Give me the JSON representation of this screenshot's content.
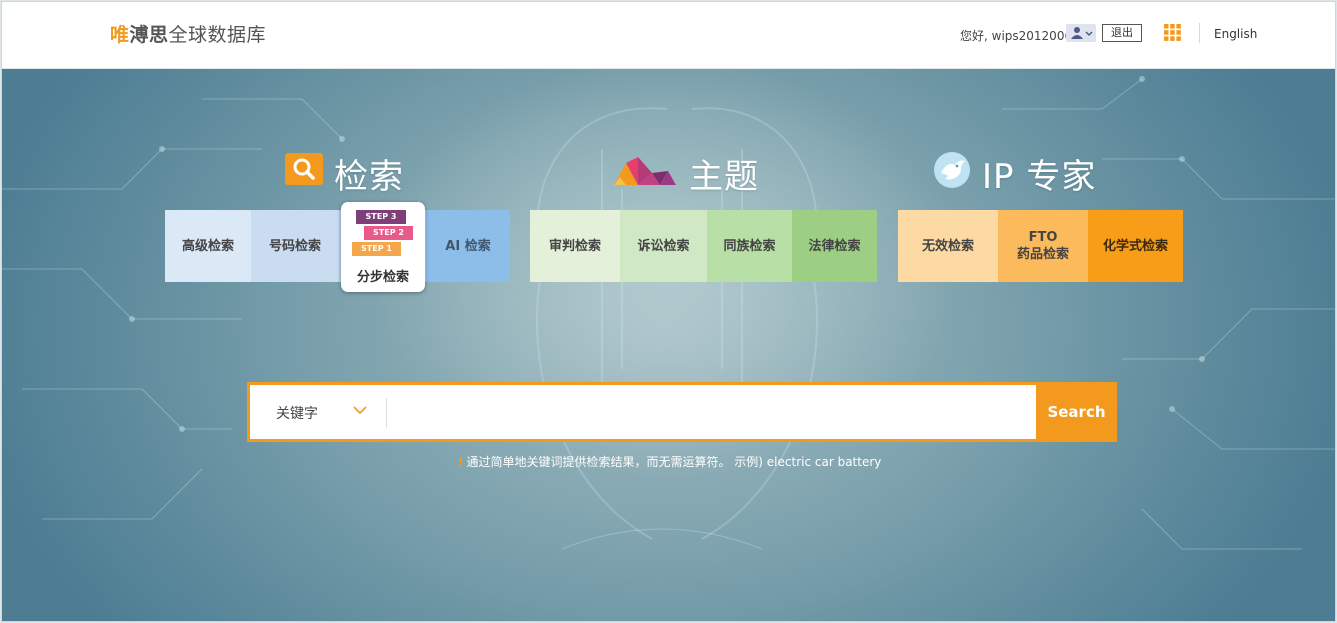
{
  "header": {
    "logo_part1": "唯",
    "logo_part2": "溥思",
    "logo_part3": "全球数据库",
    "greeting": "您好, wips2012006",
    "logout_label": "退出",
    "language_label": "English"
  },
  "sections": {
    "search": {
      "title": "检索",
      "tiles": {
        "advanced": "高级检索",
        "number": "号码检索",
        "step": "分步检索",
        "step_pills": [
          "STEP 3",
          "STEP 2",
          "STEP 1"
        ],
        "ai": "AI 检索"
      }
    },
    "theme": {
      "title": "主题",
      "tiles": {
        "review": "审判检索",
        "litigation": "诉讼检索",
        "family": "同族检索",
        "legal": "法律检索"
      }
    },
    "expert": {
      "title": "IP 专家",
      "tiles": {
        "invalid": "无效检索",
        "fto_line1": "FTO",
        "fto_line2": "药品检索",
        "chemical": "化学式检索"
      }
    }
  },
  "search_bar": {
    "type_selected": "关键字",
    "input_value": "",
    "button_label": "Search",
    "hint_mark": "!",
    "hint_text": "通过简单地关键词提供检索结果，而无需运算符。   示例) electric car battery"
  },
  "colors": {
    "accent": "#f39a1e"
  },
  "icons": [
    "search-icon",
    "theme-logo-icon",
    "expert-bird-icon",
    "user-icon",
    "apps-grid-icon",
    "chevron-down-icon"
  ]
}
